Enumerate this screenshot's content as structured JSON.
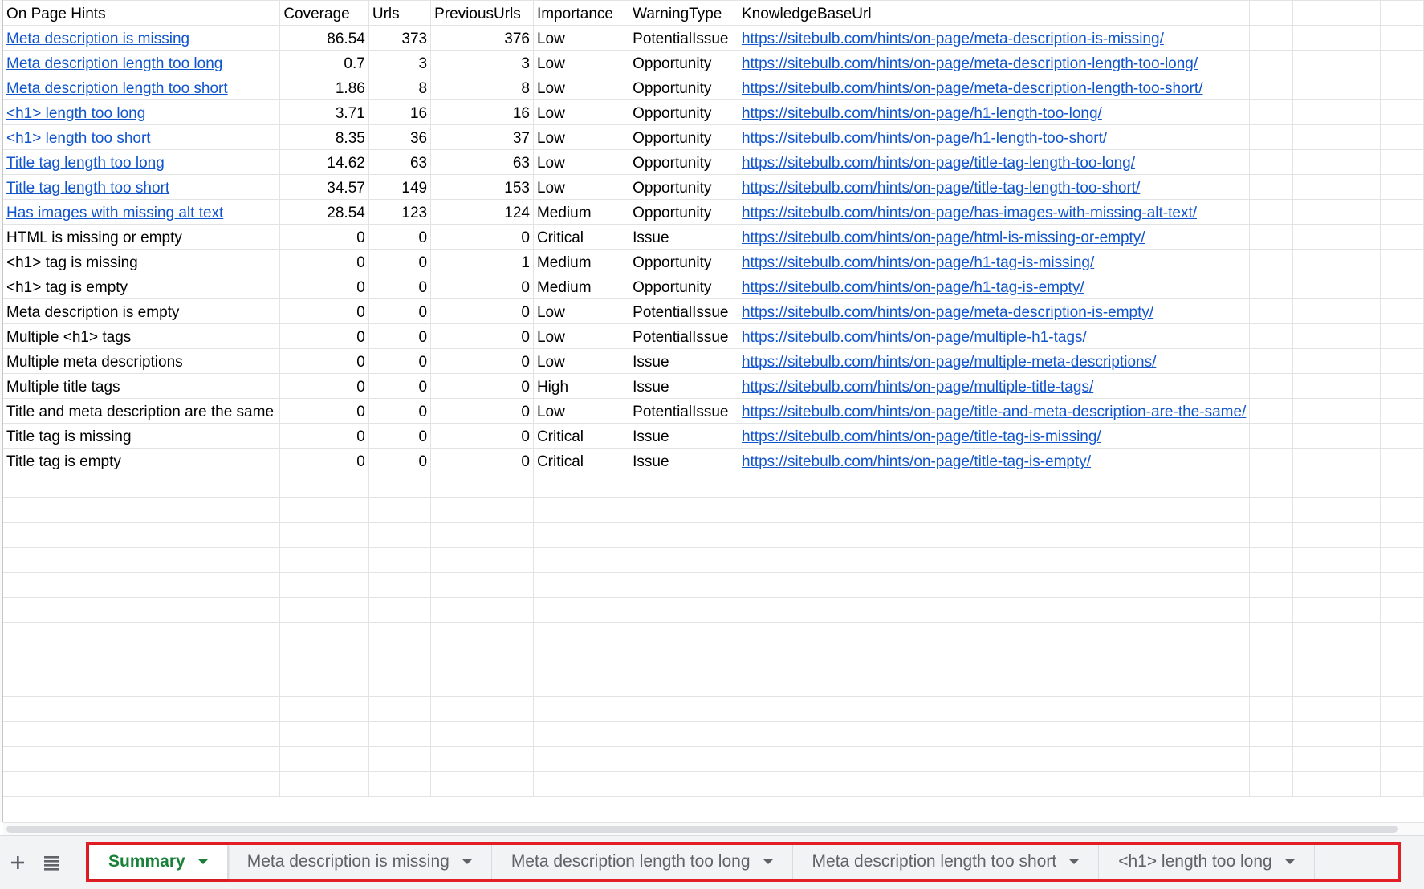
{
  "sheet": {
    "headers": [
      "On Page Hints",
      "Coverage",
      "Urls",
      "PreviousUrls",
      "Importance",
      "WarningType",
      "KnowledgeBaseUrl"
    ],
    "rows": [
      [
        "Meta description is missing",
        "86.54",
        "373",
        "376",
        "Low",
        "PotentialIssue",
        "https://sitebulb.com/hints/on-page/meta-description-is-missing/"
      ],
      [
        "Meta description length too long",
        "0.7",
        "3",
        "3",
        "Low",
        "Opportunity",
        "https://sitebulb.com/hints/on-page/meta-description-length-too-long/"
      ],
      [
        "Meta description length too short",
        "1.86",
        "8",
        "8",
        "Low",
        "Opportunity",
        "https://sitebulb.com/hints/on-page/meta-description-length-too-short/"
      ],
      [
        "<h1> length too long",
        "3.71",
        "16",
        "16",
        "Low",
        "Opportunity",
        "https://sitebulb.com/hints/on-page/h1-length-too-long/"
      ],
      [
        "<h1> length too short",
        "8.35",
        "36",
        "37",
        "Low",
        "Opportunity",
        "https://sitebulb.com/hints/on-page/h1-length-too-short/"
      ],
      [
        "Title tag length too long",
        "14.62",
        "63",
        "63",
        "Low",
        "Opportunity",
        "https://sitebulb.com/hints/on-page/title-tag-length-too-long/"
      ],
      [
        "Title tag length too short",
        "34.57",
        "149",
        "153",
        "Low",
        "Opportunity",
        "https://sitebulb.com/hints/on-page/title-tag-length-too-short/"
      ],
      [
        "Has images with missing alt text",
        "28.54",
        "123",
        "124",
        "Medium",
        "Opportunity",
        "https://sitebulb.com/hints/on-page/has-images-with-missing-alt-text/"
      ],
      [
        "HTML is missing or empty",
        "0",
        "0",
        "0",
        "Critical",
        "Issue",
        "https://sitebulb.com/hints/on-page/html-is-missing-or-empty/"
      ],
      [
        "<h1> tag is missing",
        "0",
        "0",
        "1",
        "Medium",
        "Opportunity",
        "https://sitebulb.com/hints/on-page/h1-tag-is-missing/"
      ],
      [
        "<h1> tag is empty",
        "0",
        "0",
        "0",
        "Medium",
        "Opportunity",
        "https://sitebulb.com/hints/on-page/h1-tag-is-empty/"
      ],
      [
        "Meta description is empty",
        "0",
        "0",
        "0",
        "Low",
        "PotentialIssue",
        "https://sitebulb.com/hints/on-page/meta-description-is-empty/"
      ],
      [
        "Multiple <h1> tags",
        "0",
        "0",
        "0",
        "Low",
        "PotentialIssue",
        "https://sitebulb.com/hints/on-page/multiple-h1-tags/"
      ],
      [
        "Multiple meta descriptions",
        "0",
        "0",
        "0",
        "Low",
        "Issue",
        "https://sitebulb.com/hints/on-page/multiple-meta-descriptions/"
      ],
      [
        "Multiple title tags",
        "0",
        "0",
        "0",
        "High",
        "Issue",
        "https://sitebulb.com/hints/on-page/multiple-title-tags/"
      ],
      [
        "Title and meta description are the same",
        "0",
        "0",
        "0",
        "Low",
        "PotentialIssue",
        "https://sitebulb.com/hints/on-page/title-and-meta-description-are-the-same/"
      ],
      [
        "Title tag is missing",
        "0",
        "0",
        "0",
        "Critical",
        "Issue",
        "https://sitebulb.com/hints/on-page/title-tag-is-missing/"
      ],
      [
        "Title tag is empty",
        "0",
        "0",
        "0",
        "Critical",
        "Issue",
        "https://sitebulb.com/hints/on-page/title-tag-is-empty/"
      ]
    ],
    "linked_hint_rows": 8,
    "empty_rows": 13
  },
  "tabbar": {
    "add_icon": "plus-icon",
    "list_icon": "list-icon",
    "tabs": [
      {
        "label": "Summary",
        "active": true
      },
      {
        "label": "Meta description is missing",
        "active": false
      },
      {
        "label": "Meta description length too long",
        "active": false
      },
      {
        "label": "Meta description length too short",
        "active": false
      },
      {
        "label": "<h1> length too long",
        "active": false
      }
    ],
    "highlight_color": "#e31e24",
    "active_color": "#188038",
    "link_color": "#1155cc"
  }
}
